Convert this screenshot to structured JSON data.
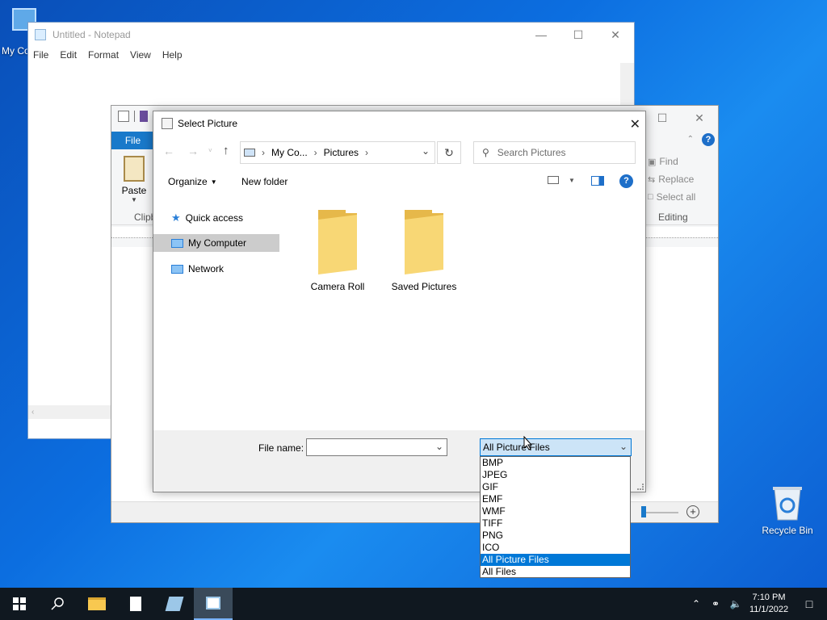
{
  "desktop": {
    "my_computer_label": "My Co",
    "recycle_bin_label": "Recycle Bin"
  },
  "notepad": {
    "title": "Untitled - Notepad",
    "menu": [
      "File",
      "Edit",
      "Format",
      "View",
      "Help"
    ]
  },
  "paint": {
    "file_tab": "File",
    "paste_label": "Paste",
    "clipboard_group": "Clipb",
    "find_label": "Find",
    "replace_label": "Replace",
    "select_all_label": "Select all",
    "editing_group": "Editing"
  },
  "dialog": {
    "title": "Select Picture",
    "breadcrumb": [
      "My Co...",
      "Pictures"
    ],
    "search_placeholder": "Search Pictures",
    "organize_label": "Organize",
    "new_folder_label": "New folder",
    "nav": [
      {
        "label": "Quick access",
        "icon": "star-icon"
      },
      {
        "label": "My Computer",
        "icon": "computer-icon",
        "selected": true
      },
      {
        "label": "Network",
        "icon": "network-icon"
      }
    ],
    "folders": [
      "Camera Roll",
      "Saved Pictures"
    ],
    "file_name_label": "File name:",
    "file_name_value": "",
    "file_type_selected": "All Picture Files",
    "file_type_options": [
      "BMP",
      "JPEG",
      "GIF",
      "EMF",
      "WMF",
      "TIFF",
      "PNG",
      "ICO",
      "All Picture Files",
      "All Files"
    ]
  },
  "taskbar": {
    "time": "7:10 PM",
    "date": "11/1/2022"
  },
  "colors": {
    "accent": "#0078d7",
    "paint_file_tab": "#1979ca",
    "folder_yellow": "#f8d775",
    "help_blue": "#1e6fc9"
  }
}
